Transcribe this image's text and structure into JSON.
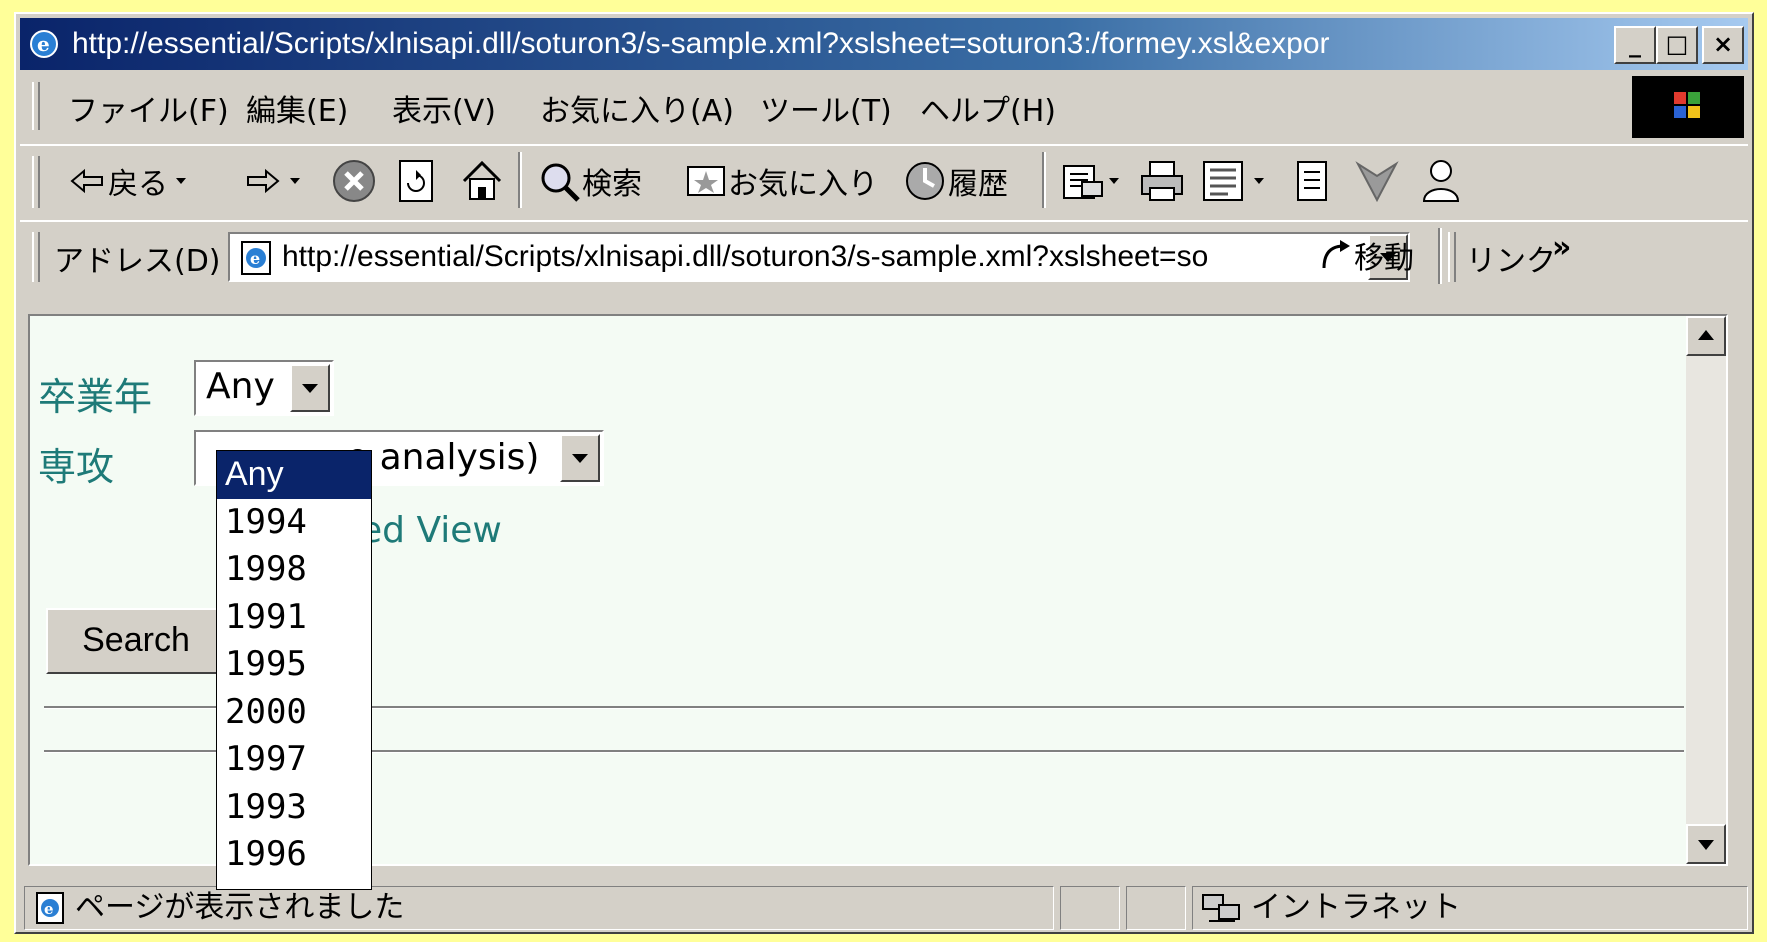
{
  "window": {
    "title": "http://essential/Scripts/xlnisapi.dll/soturon3/s-sample.xml?xslsheet=soturon3:/formey.xsl&expor",
    "caption": {
      "minimize": "_",
      "maximize": "□",
      "close": "×"
    }
  },
  "menu": [
    {
      "label": "ファイル(F)"
    },
    {
      "label": "編集(E)"
    },
    {
      "label": "表示(V)"
    },
    {
      "label": "お気に入り(A)"
    },
    {
      "label": "ツール(T)"
    },
    {
      "label": "ヘルプ(H)"
    }
  ],
  "toolbar": {
    "back": "戻る",
    "search": "検索",
    "favorites": "お気に入り",
    "history": "履歴"
  },
  "address": {
    "label": "アドレス(D)",
    "url": "http://essential/Scripts/xlnisapi.dll/soturon3/s-sample.xml?xslsheet=so",
    "go": "移動",
    "links": "リンク",
    "more": "»"
  },
  "form": {
    "year_label": "卒業年",
    "year_value": "Any",
    "major_label": "専攻",
    "major_value": "e analysis)",
    "detail_link": "led View",
    "search_button": "Search"
  },
  "year_options": [
    "Any",
    "1994",
    "1998",
    "1991",
    "1995",
    "2000",
    "1997",
    "1993",
    "1996"
  ],
  "status": {
    "message": "ページが表示されました",
    "zone": "イントラネット"
  },
  "colors": {
    "title_bar": "#0a246a",
    "label_text": "#1e7a78",
    "selected_option": "#0a246a",
    "page_background": "#ffff99"
  }
}
